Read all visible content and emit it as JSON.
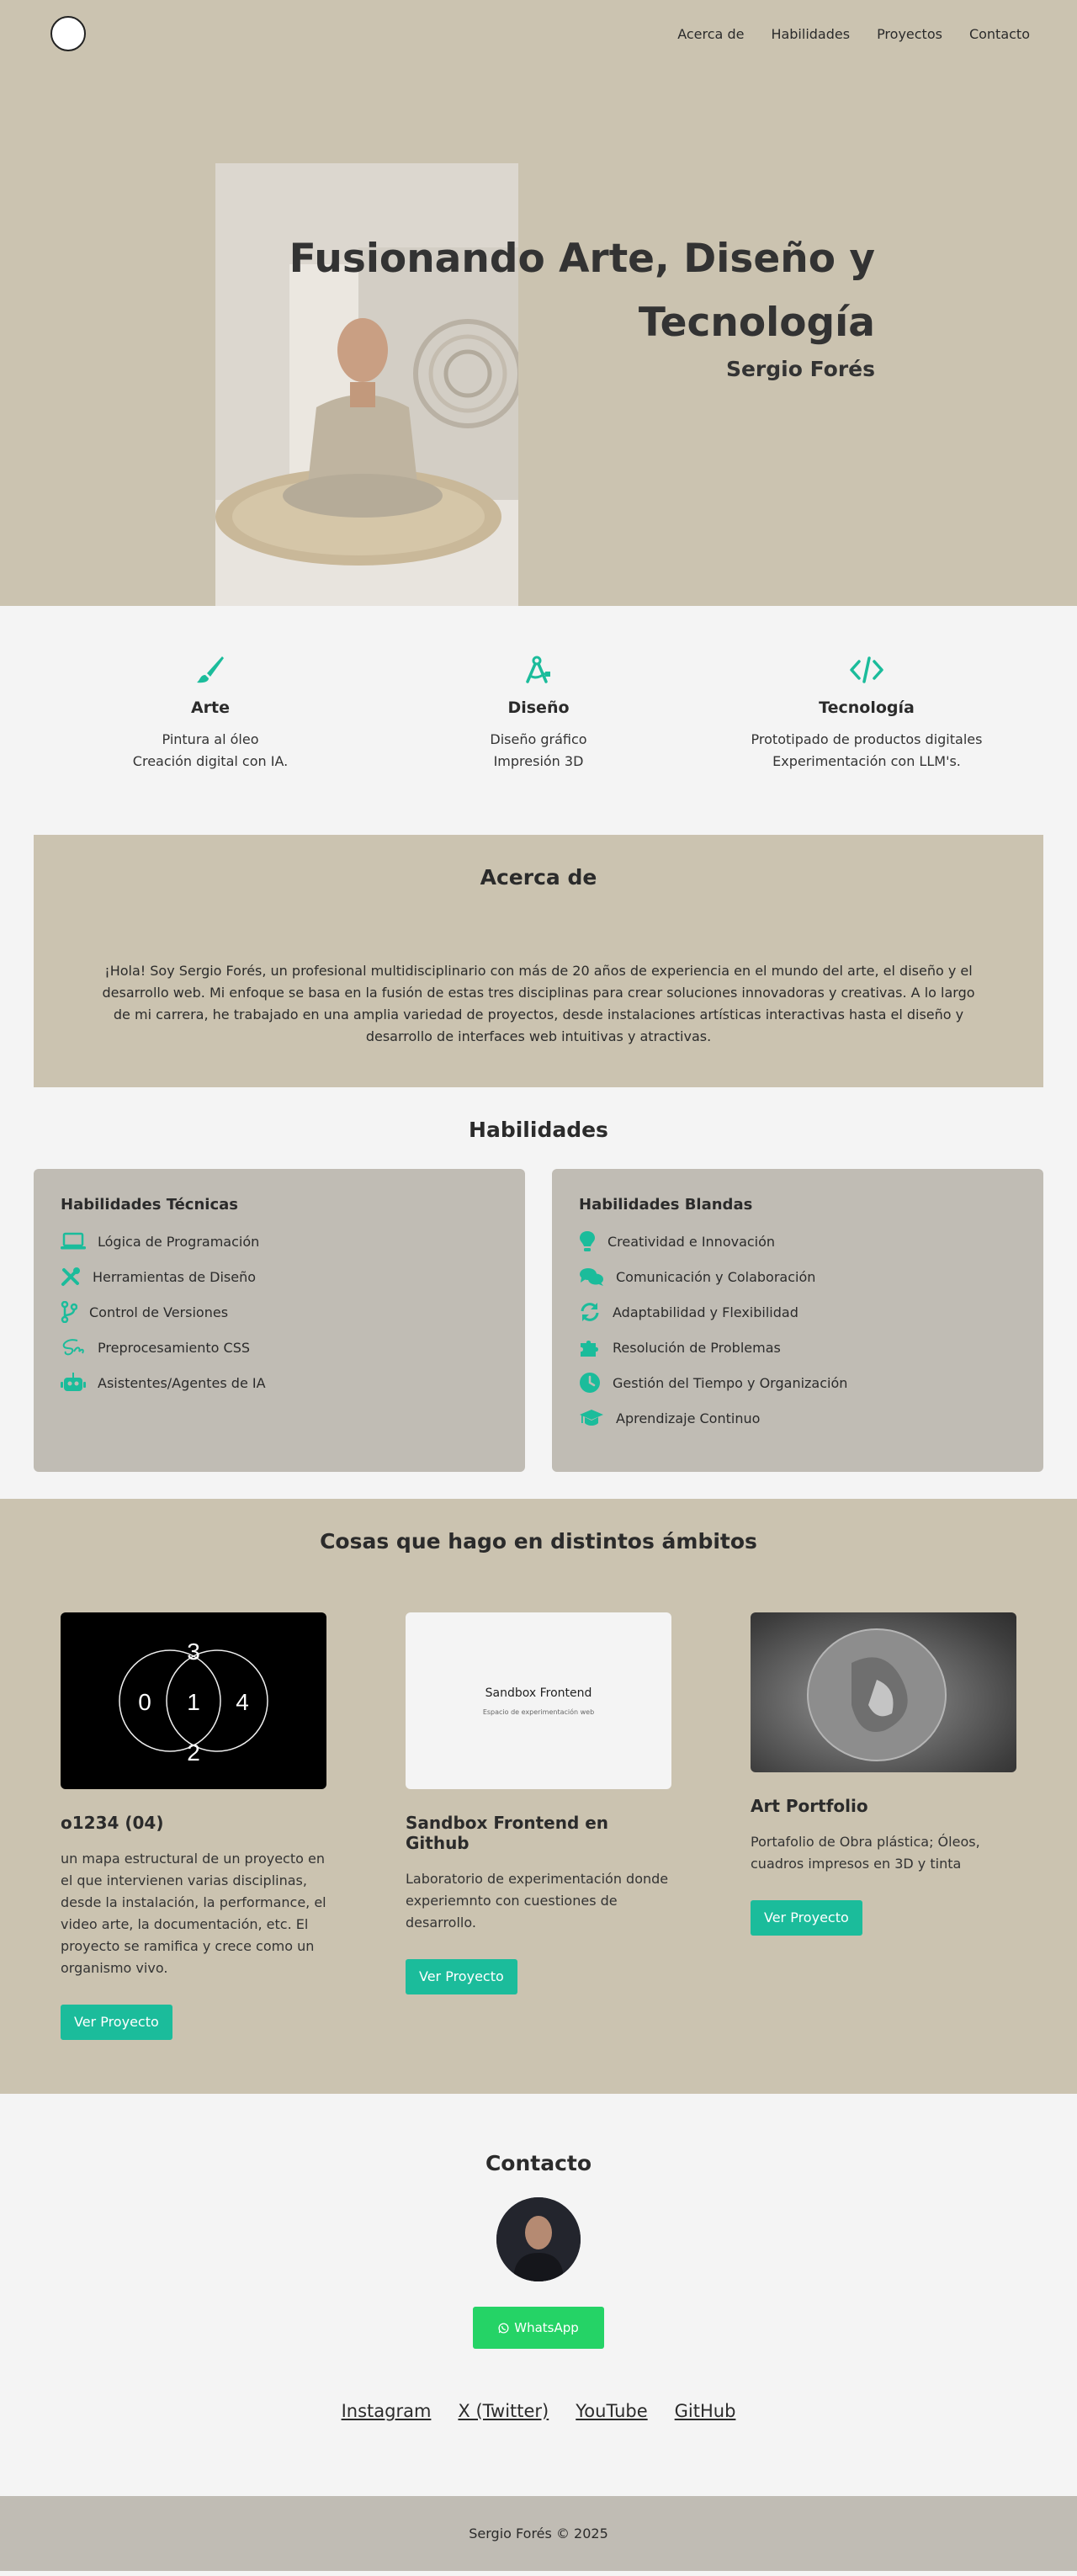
{
  "nav": {
    "links": [
      "Acerca de",
      "Habilidades",
      "Proyectos",
      "Contacto"
    ]
  },
  "hero": {
    "title": "Fusionando Arte, Diseño y Tecnología",
    "subtitle": "Sergio Forés"
  },
  "pillars": [
    {
      "icon": "paintbrush-icon",
      "title": "Arte",
      "lines": [
        "Pintura al óleo",
        "Creación digital con IA."
      ]
    },
    {
      "icon": "compass-drafting-icon",
      "title": "Diseño",
      "lines": [
        "Diseño gráfico",
        "Impresión 3D"
      ]
    },
    {
      "icon": "code-icon",
      "title": "Tecnología",
      "lines": [
        "Prototipado de productos digitales",
        "Experimentación con LLM's."
      ]
    }
  ],
  "about": {
    "title": "Acerca de",
    "text": "¡Hola! Soy Sergio Forés, un profesional multidisciplinario con más de 20 años de experiencia en el mundo del arte, el diseño y el desarrollo web. Mi enfoque se basa en la fusión de estas tres disciplinas para crear soluciones innovadoras y creativas. A lo largo de mi carrera, he trabajado en una amplia variedad de proyectos, desde instalaciones artísticas interactivas hasta el diseño y desarrollo de interfaces web intuitivas y atractivas."
  },
  "skills": {
    "title": "Habilidades",
    "technical": {
      "title": "Habilidades Técnicas",
      "items": [
        {
          "icon": "laptop-code-icon",
          "label": "Lógica de Programación"
        },
        {
          "icon": "tools-icon",
          "label": "Herramientas de Diseño"
        },
        {
          "icon": "code-branch-icon",
          "label": "Control de Versiones"
        },
        {
          "icon": "sass-icon",
          "label": "Preprocesamiento CSS"
        },
        {
          "icon": "robot-icon",
          "label": "Asistentes/Agentes de IA"
        }
      ]
    },
    "soft": {
      "title": "Habilidades Blandas",
      "items": [
        {
          "icon": "lightbulb-icon",
          "label": "Creatividad e Innovación"
        },
        {
          "icon": "comments-icon",
          "label": "Comunicación y Colaboración"
        },
        {
          "icon": "sync-icon",
          "label": "Adaptabilidad y Flexibilidad"
        },
        {
          "icon": "puzzle-icon",
          "label": "Resolución de Problemas"
        },
        {
          "icon": "clock-icon",
          "label": "Gestión del Tiempo y Organización"
        },
        {
          "icon": "graduation-cap-icon",
          "label": "Aprendizaje Continuo"
        }
      ]
    }
  },
  "projects": {
    "title": "Cosas que hago en distintos ámbitos",
    "items": [
      {
        "title": "o1234 (04)",
        "desc": "un mapa estructural de un proyecto en el que intervienen varias disciplinas, desde la instalación, la performance, el video arte, la documentación, etc. El proyecto se ramifica y crece como un organismo vivo.",
        "button": "Ver Proyecto",
        "image_digits": [
          "3",
          "0",
          "1",
          "4",
          "2"
        ]
      },
      {
        "title": "Sandbox Frontend en Github",
        "desc": "Laboratorio de experimentación donde experiemnto con cuestiones de desarrollo.",
        "button": "Ver Proyecto",
        "image_title": "Sandbox Frontend",
        "image_sub": "Espacio de experimentación web"
      },
      {
        "title": "Art Portfolio",
        "desc": "Portafolio de Obra plástica; Óleos, cuadros impresos en 3D y tinta",
        "button": "Ver Proyecto"
      }
    ]
  },
  "contact": {
    "title": "Contacto",
    "whatsapp": "WhatsApp",
    "socials": [
      "Instagram",
      "X (Twitter)",
      "YouTube",
      "GitHub"
    ]
  },
  "footer": {
    "text": "Sergio Forés © 2025"
  },
  "colors": {
    "accent": "#1bbc9b",
    "beige": "#cbc3b0",
    "card": "#c0bcb4",
    "whatsapp": "#25d366"
  }
}
